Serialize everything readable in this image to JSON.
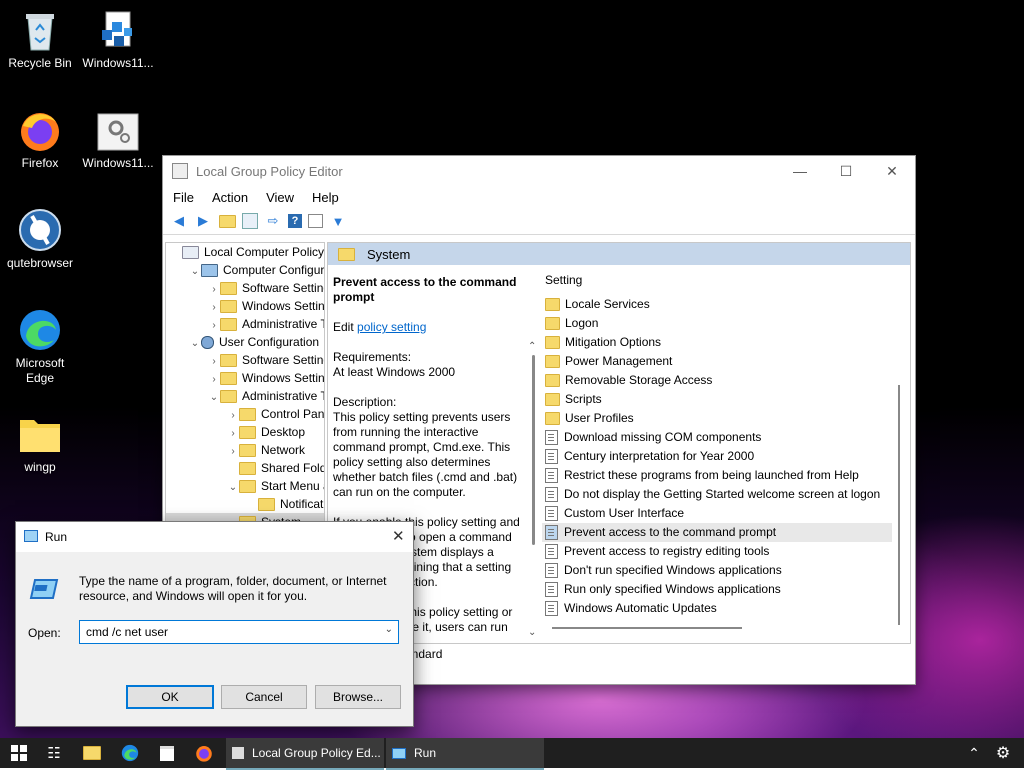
{
  "desktop": {
    "icons": [
      {
        "label": "Recycle Bin"
      },
      {
        "label": "Windows11..."
      },
      {
        "label": "Firefox"
      },
      {
        "label": "Windows11..."
      },
      {
        "label": "qutebrowser"
      },
      {
        "label": "Microsoft Edge"
      },
      {
        "label": "wingp"
      }
    ]
  },
  "gpe": {
    "title": "Local Group Policy Editor",
    "menu": [
      "File",
      "Action",
      "View",
      "Help"
    ],
    "tree": [
      {
        "label": "Local Computer Policy",
        "depth": 0,
        "arrow": "",
        "icon": "policy"
      },
      {
        "label": "Computer Configura",
        "depth": 1,
        "arrow": "v",
        "icon": "computer"
      },
      {
        "label": "Software Settings",
        "depth": 2,
        "arrow": ">",
        "icon": "folder"
      },
      {
        "label": "Windows Setting",
        "depth": 2,
        "arrow": ">",
        "icon": "folder"
      },
      {
        "label": "Administrative Te",
        "depth": 2,
        "arrow": ">",
        "icon": "folder"
      },
      {
        "label": "User Configuration",
        "depth": 1,
        "arrow": "v",
        "icon": "user"
      },
      {
        "label": "Software Settings",
        "depth": 2,
        "arrow": ">",
        "icon": "folder"
      },
      {
        "label": "Windows Setting",
        "depth": 2,
        "arrow": ">",
        "icon": "folder"
      },
      {
        "label": "Administrative Te",
        "depth": 2,
        "arrow": "v",
        "icon": "folder"
      },
      {
        "label": "Control Panel",
        "depth": 3,
        "arrow": ">",
        "icon": "folder"
      },
      {
        "label": "Desktop",
        "depth": 3,
        "arrow": ">",
        "icon": "folder"
      },
      {
        "label": "Network",
        "depth": 3,
        "arrow": ">",
        "icon": "folder"
      },
      {
        "label": "Shared Folder",
        "depth": 3,
        "arrow": "",
        "icon": "folder"
      },
      {
        "label": "Start Menu ar",
        "depth": 3,
        "arrow": "v",
        "icon": "folder"
      },
      {
        "label": "Notificatio",
        "depth": 4,
        "arrow": "",
        "icon": "folder"
      },
      {
        "label": "System",
        "depth": 3,
        "arrow": ">",
        "icon": "folder"
      }
    ],
    "header": "System",
    "description": {
      "title": "Prevent access to the command prompt",
      "edit_prefix": "Edit ",
      "edit_link": "policy setting",
      "requirements_label": "Requirements:",
      "requirements_value": "At least Windows 2000",
      "description_label": "Description:",
      "description_text": "This policy setting prevents users from running the interactive command prompt, Cmd.exe. This policy setting also determines whether batch files (.cmd and .bat) can run on the computer.",
      "para2": "If you enable this policy setting and the user tries to open a command window, the system displays a message explaining that a setting prevents the action.",
      "para3": "If you disable this policy setting or do not configure it, users can run"
    },
    "list_header": "Setting",
    "settings": [
      {
        "label": "Locale Services",
        "type": "folder",
        "selected": false
      },
      {
        "label": "Logon",
        "type": "folder",
        "selected": false
      },
      {
        "label": "Mitigation Options",
        "type": "folder",
        "selected": false
      },
      {
        "label": "Power Management",
        "type": "folder",
        "selected": false
      },
      {
        "label": "Removable Storage Access",
        "type": "folder",
        "selected": false
      },
      {
        "label": "Scripts",
        "type": "folder",
        "selected": false
      },
      {
        "label": "User Profiles",
        "type": "folder",
        "selected": false
      },
      {
        "label": "Download missing COM components",
        "type": "policy",
        "selected": false
      },
      {
        "label": "Century interpretation for Year 2000",
        "type": "policy",
        "selected": false
      },
      {
        "label": "Restrict these programs from being launched from Help",
        "type": "policy",
        "selected": false
      },
      {
        "label": "Do not display the Getting Started welcome screen at logon",
        "type": "policy",
        "selected": false
      },
      {
        "label": "Custom User Interface",
        "type": "policy",
        "selected": false
      },
      {
        "label": "Prevent access to the command prompt",
        "type": "policy",
        "selected": true
      },
      {
        "label": "Prevent access to registry editing tools",
        "type": "policy",
        "selected": false
      },
      {
        "label": "Don't run specified Windows applications",
        "type": "policy",
        "selected": false
      },
      {
        "label": "Run only specified Windows applications",
        "type": "policy",
        "selected": false
      },
      {
        "label": "Windows Automatic Updates",
        "type": "policy",
        "selected": false
      }
    ],
    "tab": "andard"
  },
  "run": {
    "title": "Run",
    "prompt": "Type the name of a program, folder, document, or Internet resource, and Windows will open it for you.",
    "open_label": "Open:",
    "open_value": "cmd /c net user",
    "ok": "OK",
    "cancel": "Cancel",
    "browse": "Browse..."
  },
  "taskbar": {
    "tasks": [
      {
        "label": "Local Group Policy Ed..."
      },
      {
        "label": "Run"
      }
    ]
  },
  "colors": {
    "accent": "#0078d7",
    "header": "#c5d6ea",
    "folder": "#f6d96b"
  }
}
